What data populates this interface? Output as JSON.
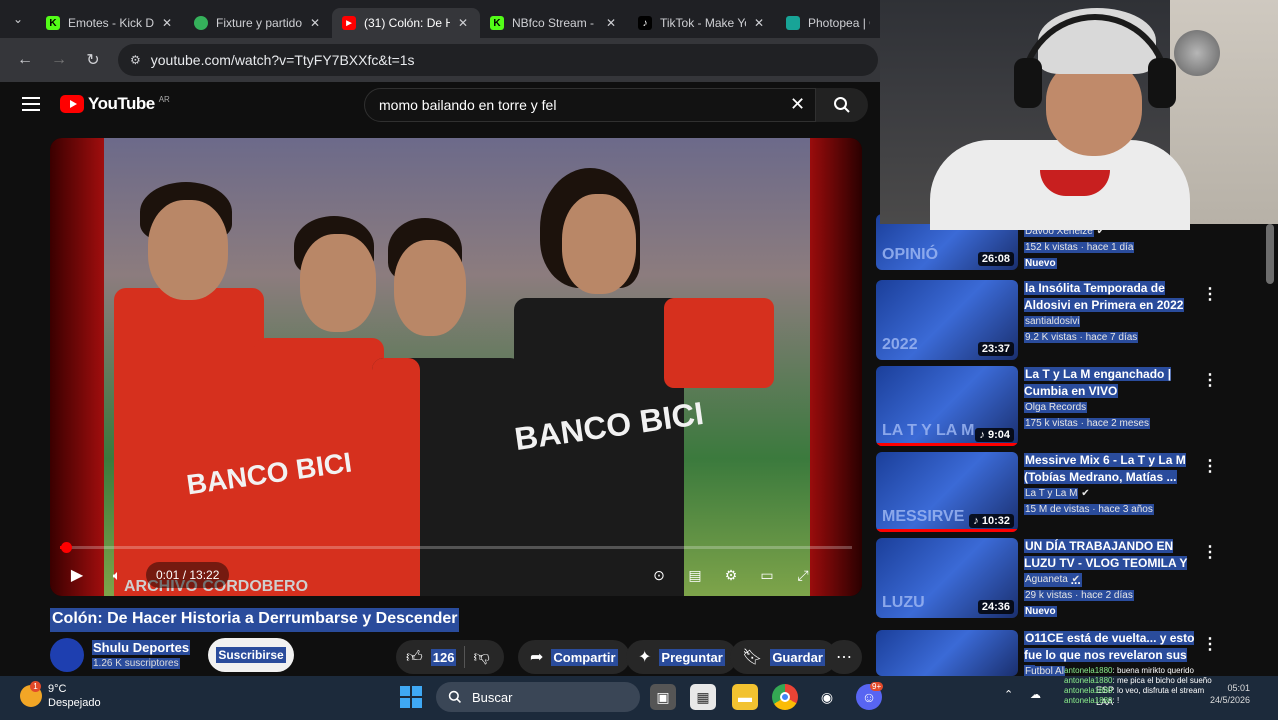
{
  "browser": {
    "tabs": [
      {
        "title": "Emotes - Kick Das",
        "icon": "kick-icon",
        "color": "#53fc18",
        "active": false
      },
      {
        "title": "Fixture y partidos",
        "icon": "globe-icon",
        "color": "#35b15b",
        "active": false
      },
      {
        "title": "(31) Colón: De H",
        "icon": "youtube-icon",
        "color": "#ff0000",
        "active": true
      },
      {
        "title": "NBfco Stream - K",
        "icon": "kick-icon",
        "color": "#53fc18",
        "active": false
      },
      {
        "title": "TikTok - Make Yo",
        "icon": "tiktok-icon",
        "color": "#ffffff",
        "active": false
      },
      {
        "title": "Photopea | Onl",
        "icon": "photopea-icon",
        "color": "#18a497",
        "active": false
      }
    ],
    "url": "youtube.com/watch?v=TtyFY7BXXfc&t=1s"
  },
  "youtube": {
    "logo_text": "YouTube",
    "region": "AR",
    "search_query": "momo bailando en torre y fel"
  },
  "player": {
    "current_time": "0:01",
    "duration": "13:22",
    "time_display": "0:01 / 13:22",
    "progress_fraction": 0.0012,
    "watermark": "ARCHIVO CORDOBERO",
    "sponsor_text": "BANCO BICI"
  },
  "video": {
    "title": "Colón: De Hacer Historia a Derrumbarse y Descender",
    "channel": "Shulu Deportes",
    "subscribers": "1.26 K suscriptores",
    "subscribe_label": "Suscribirse",
    "likes": "126",
    "share_label": "Compartir",
    "ask_label": "Preguntar",
    "save_label": "Guardar"
  },
  "recommendations": [
    {
      "title": "",
      "channel": "Davoo Xeneize",
      "verified": true,
      "meta": "152 k vistas · hace 1 día",
      "badge": "Nuevo",
      "duration": "26:08",
      "thumb_text": "OPINIÓ"
    },
    {
      "title": "la Insólita Temporada de Aldosivi en Primera en 2022",
      "channel": "santialdosivi",
      "verified": false,
      "meta": "9.2 K vistas · hace 7 días",
      "badge": "",
      "duration": "23:37",
      "thumb_text": "2022"
    },
    {
      "title": "La T y La M enganchado | Cumbia en VIVO",
      "channel": "Olga Records",
      "verified": false,
      "meta": "175 k vistas · hace 2 meses",
      "badge": "",
      "duration": "9:04",
      "thumb_text": "LA T Y LA M"
    },
    {
      "title": "Messirve Mix 6 - La T y La M (Tobías Medrano, Matías ...",
      "channel": "La T y La M",
      "verified": true,
      "meta": "15 M de vistas · hace 3 años",
      "badge": "",
      "duration": "10:32",
      "thumb_text": "MESSIRVE"
    },
    {
      "title": "UN DÍA TRABAJANDO EN LUZU TV - VLOG TEOMILA Y SE FUE ...",
      "channel": "Aguaneta",
      "verified": true,
      "meta": "29 k vistas · hace 2 días",
      "badge": "Nuevo",
      "duration": "24:36",
      "thumb_text": "LUZU"
    },
    {
      "title": "O11CE está de vuelta... y esto fue lo que nos revelaron sus ...",
      "channel": "Futbol Al",
      "verified": false,
      "meta": "",
      "badge": "",
      "duration": "",
      "thumb_text": ""
    }
  ],
  "chat": [
    {
      "user": "antonela1880",
      "msg": "buena mirikto querido"
    },
    {
      "user": "antonela1880",
      "msg": "me pica el bicho del sueño"
    },
    {
      "user": "antonela1880",
      "msg": "lo veo, disfruta el stream"
    },
    {
      "user": "antonela1880",
      "msg": "!"
    }
  ],
  "taskbar": {
    "temperature": "9°C",
    "condition": "Despejado",
    "weather_badge": "1",
    "search_label": "Buscar",
    "lang": "ESP",
    "lang2": "LAA",
    "time": "05:01",
    "date": "24/5/2026",
    "discord_badge": "9+"
  },
  "colors": {
    "youtube_red": "#ff0000",
    "highlight": "#2a4c9c",
    "taskbar": "#1c2a3b"
  }
}
